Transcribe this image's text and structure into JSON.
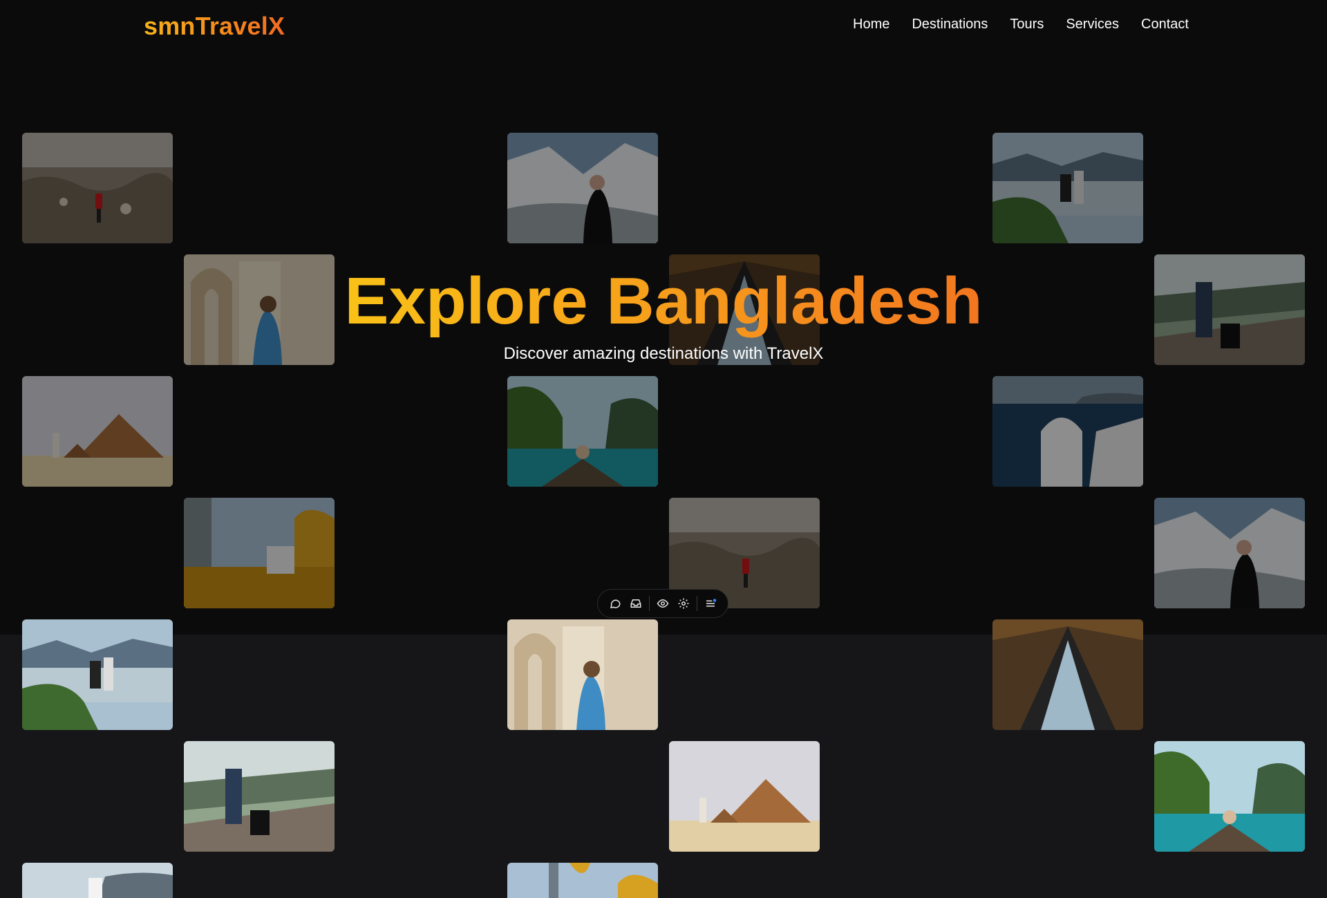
{
  "brand": {
    "logo_text": "smnTravelX"
  },
  "nav": {
    "links": [
      "Home",
      "Destinations",
      "Tours",
      "Services",
      "Contact"
    ]
  },
  "hero": {
    "title": "Explore Bangladesh",
    "subtitle": "Discover amazing destinations with TravelX"
  },
  "toolbar": {
    "icons": [
      "comment-icon",
      "inbox-icon",
      "eye-icon",
      "settings-icon",
      "menu-icon"
    ],
    "colors": {
      "background": "#0a0a0b",
      "notification_dot": "#3b82f6"
    }
  },
  "gallery": {
    "scenes": [
      "cappadocia-red-jacket",
      "snow-valley-hijab",
      "lake-hikers",
      "arches-photographer",
      "tent-glamping",
      "train-station-suitcase",
      "pyramid-photographer",
      "boat-lagoon",
      "santorini-bell",
      "yellow-palace-window"
    ]
  },
  "colors": {
    "background": "#0b0b0c",
    "lower_band": "#161619",
    "accent_start": "#f9c117",
    "accent_end": "#f2761f",
    "nav_text": "#ffffff"
  }
}
